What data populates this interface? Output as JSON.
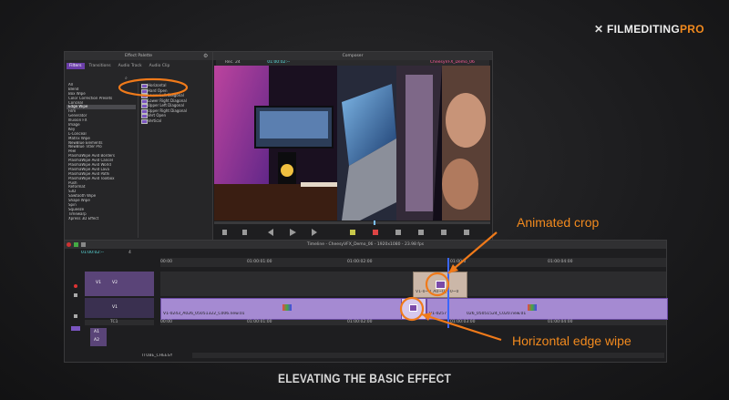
{
  "brand": {
    "mark": "✕",
    "name_white": "FILMEDITING",
    "name_orange": "PRO"
  },
  "effect_palette": {
    "title": "Effect Palette",
    "tabs": [
      "Effect Palette",
      "Transitions",
      "Audio Track",
      "Audio Clip"
    ],
    "active_tab": "Effect Palette",
    "subtab": "Filters",
    "categories": [
      "All",
      "Blend",
      "Box Wipe",
      "Color Correction Presets",
      "Conceal",
      "Edge Wipe",
      "Film",
      "Generator",
      "Illusion FX",
      "Image",
      "Key",
      "L-Conceal",
      "Matrix Wipe",
      "NewBlue Elements",
      "NewBlue Titler Pro",
      "Peel",
      "PlasmaWipe Avid Borders",
      "PlasmaWipe Avid Cancel",
      "PlasmaWipe Avid World",
      "PlasmaWipe Avid Lava",
      "PlasmaWipe Avid Pathi",
      "PlasmaWipe Avid Toolbox",
      "Push",
      "Reformat",
      "S3D",
      "Sawtooth Wipe",
      "Shape Wipe",
      "Spin",
      "Squeeze",
      "Timewarp",
      "Xpress 3D Effect"
    ],
    "selected_category": "Edge Wipe",
    "wipes": [
      "Horizontal",
      "Hard Open",
      "Lower Left Diagonal",
      "Lower Right Diagonal",
      "Upper Left Diagonal",
      "Upper Right Diagonal",
      "Vert Open",
      "Vertical"
    ]
  },
  "composer": {
    "title": "Composer",
    "left_label": "Rec. 24",
    "timecode": "01:00:02:--",
    "clip_name": "CheesyVFX_Demo_06"
  },
  "timeline": {
    "title": "Timeline - CheesyVFX_Demo_06 - 1920x1080 - 23.98 fps",
    "position_tc": "01:00:02:--",
    "ruler": [
      "00:00",
      "01:00:01:00",
      "01:00:02:00",
      "01:00:0",
      "01:00:04:00"
    ],
    "ruler_lower": [
      "00:00",
      "01:00:01:00",
      "01:00:02:00",
      "01:00:03:00",
      "01:00:04:00"
    ],
    "track_v2": "V2",
    "track_v1": "V1",
    "track_tc1": "TC1",
    "track_a1": "A1",
    "track_a2": "A2",
    "clip_v2": "V1-0~0_A0~0_~0~0",
    "clip_v1a": "V1-0243_A026_05051322_C006.new.01",
    "clip_v1b": "V1-0257",
    "clip_v1c": "026_05051524_C020.new.01",
    "bin_name": "ITUBE_CHEESY",
    "track_count": "4"
  },
  "annotations": {
    "animated_crop": "Animated crop",
    "horizontal_edge_wipe": "Horizontal edge wipe",
    "color": "#f07a1a"
  },
  "caption": "ELEVATING THE BASIC EFFECT"
}
